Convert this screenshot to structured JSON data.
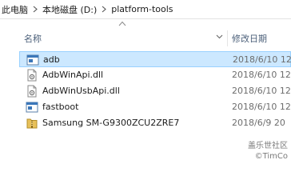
{
  "breadcrumb": {
    "items": [
      "此电脑",
      "本地磁盘 (D:)",
      "platform-tools"
    ]
  },
  "columns": {
    "name": "名称",
    "date": "修改日期"
  },
  "files": [
    {
      "name": "adb",
      "date": "2018/6/10 12",
      "icon": "application-icon",
      "selected": true
    },
    {
      "name": "AdbWinApi.dll",
      "date": "2018/6/10 12",
      "icon": "dll-file-icon",
      "selected": false
    },
    {
      "name": "AdbWinUsbApi.dll",
      "date": "2018/6/10 12",
      "icon": "dll-file-icon",
      "selected": false
    },
    {
      "name": "fastboot",
      "date": "2018/6/10 12",
      "icon": "application-icon",
      "selected": false
    },
    {
      "name": "Samsung SM-G9300ZCU2ZRE7",
      "date": "2018/6/9 20",
      "icon": "archive-icon",
      "selected": false
    }
  ],
  "watermark": {
    "line1": "盖乐世社区",
    "line2": "©TimCo"
  },
  "colors": {
    "selection_bg": "#cce8ff",
    "selection_border": "#99d1ff",
    "header_text": "#4c607a",
    "date_text": "#6d6d6d"
  }
}
